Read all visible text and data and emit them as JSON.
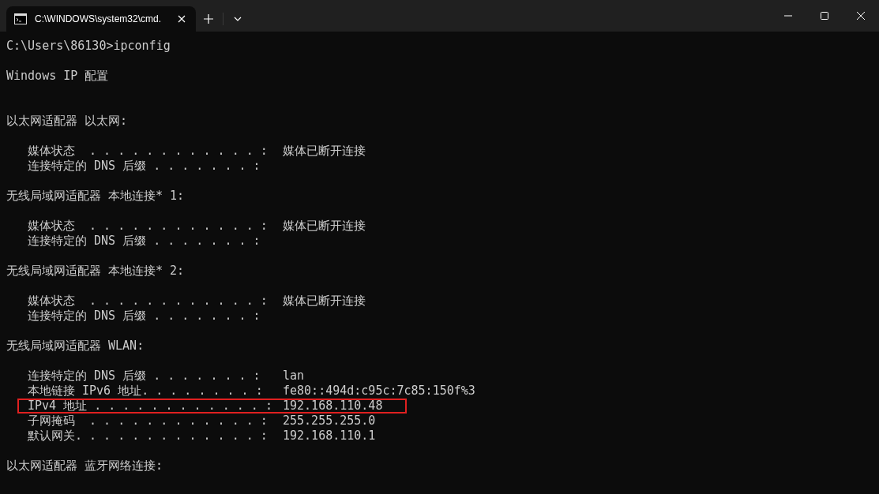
{
  "tab": {
    "title": "C:\\WINDOWS\\system32\\cmd.",
    "selected": true
  },
  "prompt": "C:\\Users\\86130>ipconfig",
  "heading": "Windows IP 配置",
  "adapters": [
    {
      "title": "以太网适配器 以太网:",
      "entries": [
        {
          "label": "媒体状态  . . . . . . . . . . . . :",
          "value": "媒体已断开连接",
          "highlighted": false
        },
        {
          "label": "连接特定的 DNS 后缀 . . . . . . . :",
          "highlighted": false
        }
      ]
    },
    {
      "title": "无线局域网适配器 本地连接* 1:",
      "entries": [
        {
          "label": "媒体状态  . . . . . . . . . . . . :",
          "value": "媒体已断开连接",
          "highlighted": false
        },
        {
          "label": "连接特定的 DNS 后缀 . . . . . . . :",
          "highlighted": false
        }
      ]
    },
    {
      "title": "无线局域网适配器 本地连接* 2:",
      "entries": [
        {
          "label": "媒体状态  . . . . . . . . . . . . :",
          "value": "媒体已断开连接",
          "highlighted": false
        },
        {
          "label": "连接特定的 DNS 后缀 . . . . . . . :",
          "highlighted": false
        }
      ]
    },
    {
      "title": "无线局域网适配器 WLAN:",
      "entries": [
        {
          "label": "连接特定的 DNS 后缀 . . . . . . . :",
          "value": "lan",
          "highlighted": false
        },
        {
          "label": "本地链接 IPv6 地址. . . . . . . . :",
          "value": "fe80::494d:c95c:7c85:150f%3",
          "highlighted": false
        },
        {
          "label": "IPv4 地址 . . . . . . . . . . . . :",
          "value": "192.168.110.48",
          "highlighted": true
        },
        {
          "label": "子网掩码  . . . . . . . . . . . . :",
          "value": "255.255.255.0",
          "highlighted": false
        },
        {
          "label": "默认网关. . . . . . . . . . . . . :",
          "value": "192.168.110.1",
          "highlighted": false
        }
      ]
    },
    {
      "title": "以太网适配器 蓝牙网络连接:"
    }
  ]
}
